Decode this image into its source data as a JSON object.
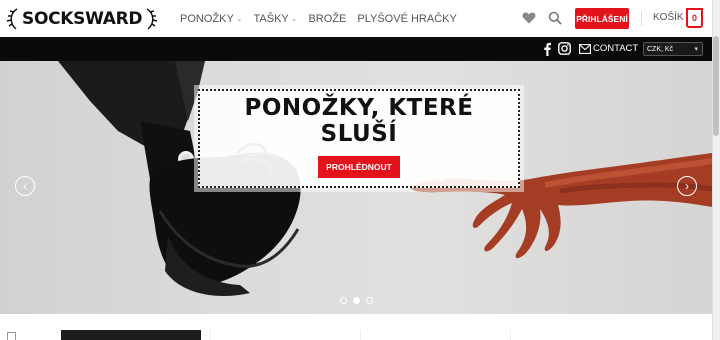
{
  "header": {
    "logo_text": "SOCKSWARD",
    "nav": [
      {
        "label": "PONOŽKY",
        "has_dropdown": true
      },
      {
        "label": "TAŠKY",
        "has_dropdown": true
      },
      {
        "label": "BROŽE",
        "has_dropdown": false
      },
      {
        "label": "PLYŠOVÉ HRAČKY",
        "has_dropdown": false
      }
    ],
    "login_label": "PŘIHLÁŠENÍ",
    "cart_label": "KOŠÍK",
    "cart_count": "0"
  },
  "topbar": {
    "contact_label": "CONTACT",
    "currency": "CZK, Kč"
  },
  "hero": {
    "title": "PONOŽKY, KTERÉ SLUŠÍ",
    "button_label": "PROHLÉDNOUT",
    "slide_count": 3,
    "active_slide": 2
  },
  "colors": {
    "accent": "#e3131b",
    "topbar_bg": "#0a0a0a"
  },
  "icons": [
    "laurel-icon",
    "heart-icon",
    "search-icon",
    "facebook-icon",
    "instagram-icon",
    "mail-icon",
    "chevron-left-icon",
    "chevron-right-icon"
  ]
}
